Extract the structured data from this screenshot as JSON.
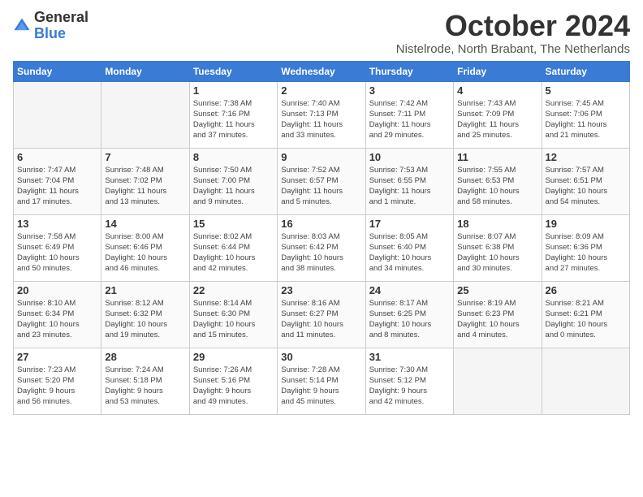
{
  "header": {
    "logo_general": "General",
    "logo_blue": "Blue",
    "month_title": "October 2024",
    "location": "Nistelrode, North Brabant, The Netherlands"
  },
  "weekdays": [
    "Sunday",
    "Monday",
    "Tuesday",
    "Wednesday",
    "Thursday",
    "Friday",
    "Saturday"
  ],
  "weeks": [
    [
      {
        "day": "",
        "detail": ""
      },
      {
        "day": "",
        "detail": ""
      },
      {
        "day": "1",
        "detail": "Sunrise: 7:38 AM\nSunset: 7:16 PM\nDaylight: 11 hours\nand 37 minutes."
      },
      {
        "day": "2",
        "detail": "Sunrise: 7:40 AM\nSunset: 7:13 PM\nDaylight: 11 hours\nand 33 minutes."
      },
      {
        "day": "3",
        "detail": "Sunrise: 7:42 AM\nSunset: 7:11 PM\nDaylight: 11 hours\nand 29 minutes."
      },
      {
        "day": "4",
        "detail": "Sunrise: 7:43 AM\nSunset: 7:09 PM\nDaylight: 11 hours\nand 25 minutes."
      },
      {
        "day": "5",
        "detail": "Sunrise: 7:45 AM\nSunset: 7:06 PM\nDaylight: 11 hours\nand 21 minutes."
      }
    ],
    [
      {
        "day": "6",
        "detail": "Sunrise: 7:47 AM\nSunset: 7:04 PM\nDaylight: 11 hours\nand 17 minutes."
      },
      {
        "day": "7",
        "detail": "Sunrise: 7:48 AM\nSunset: 7:02 PM\nDaylight: 11 hours\nand 13 minutes."
      },
      {
        "day": "8",
        "detail": "Sunrise: 7:50 AM\nSunset: 7:00 PM\nDaylight: 11 hours\nand 9 minutes."
      },
      {
        "day": "9",
        "detail": "Sunrise: 7:52 AM\nSunset: 6:57 PM\nDaylight: 11 hours\nand 5 minutes."
      },
      {
        "day": "10",
        "detail": "Sunrise: 7:53 AM\nSunset: 6:55 PM\nDaylight: 11 hours\nand 1 minute."
      },
      {
        "day": "11",
        "detail": "Sunrise: 7:55 AM\nSunset: 6:53 PM\nDaylight: 10 hours\nand 58 minutes."
      },
      {
        "day": "12",
        "detail": "Sunrise: 7:57 AM\nSunset: 6:51 PM\nDaylight: 10 hours\nand 54 minutes."
      }
    ],
    [
      {
        "day": "13",
        "detail": "Sunrise: 7:58 AM\nSunset: 6:49 PM\nDaylight: 10 hours\nand 50 minutes."
      },
      {
        "day": "14",
        "detail": "Sunrise: 8:00 AM\nSunset: 6:46 PM\nDaylight: 10 hours\nand 46 minutes."
      },
      {
        "day": "15",
        "detail": "Sunrise: 8:02 AM\nSunset: 6:44 PM\nDaylight: 10 hours\nand 42 minutes."
      },
      {
        "day": "16",
        "detail": "Sunrise: 8:03 AM\nSunset: 6:42 PM\nDaylight: 10 hours\nand 38 minutes."
      },
      {
        "day": "17",
        "detail": "Sunrise: 8:05 AM\nSunset: 6:40 PM\nDaylight: 10 hours\nand 34 minutes."
      },
      {
        "day": "18",
        "detail": "Sunrise: 8:07 AM\nSunset: 6:38 PM\nDaylight: 10 hours\nand 30 minutes."
      },
      {
        "day": "19",
        "detail": "Sunrise: 8:09 AM\nSunset: 6:36 PM\nDaylight: 10 hours\nand 27 minutes."
      }
    ],
    [
      {
        "day": "20",
        "detail": "Sunrise: 8:10 AM\nSunset: 6:34 PM\nDaylight: 10 hours\nand 23 minutes."
      },
      {
        "day": "21",
        "detail": "Sunrise: 8:12 AM\nSunset: 6:32 PM\nDaylight: 10 hours\nand 19 minutes."
      },
      {
        "day": "22",
        "detail": "Sunrise: 8:14 AM\nSunset: 6:30 PM\nDaylight: 10 hours\nand 15 minutes."
      },
      {
        "day": "23",
        "detail": "Sunrise: 8:16 AM\nSunset: 6:27 PM\nDaylight: 10 hours\nand 11 minutes."
      },
      {
        "day": "24",
        "detail": "Sunrise: 8:17 AM\nSunset: 6:25 PM\nDaylight: 10 hours\nand 8 minutes."
      },
      {
        "day": "25",
        "detail": "Sunrise: 8:19 AM\nSunset: 6:23 PM\nDaylight: 10 hours\nand 4 minutes."
      },
      {
        "day": "26",
        "detail": "Sunrise: 8:21 AM\nSunset: 6:21 PM\nDaylight: 10 hours\nand 0 minutes."
      }
    ],
    [
      {
        "day": "27",
        "detail": "Sunrise: 7:23 AM\nSunset: 5:20 PM\nDaylight: 9 hours\nand 56 minutes."
      },
      {
        "day": "28",
        "detail": "Sunrise: 7:24 AM\nSunset: 5:18 PM\nDaylight: 9 hours\nand 53 minutes."
      },
      {
        "day": "29",
        "detail": "Sunrise: 7:26 AM\nSunset: 5:16 PM\nDaylight: 9 hours\nand 49 minutes."
      },
      {
        "day": "30",
        "detail": "Sunrise: 7:28 AM\nSunset: 5:14 PM\nDaylight: 9 hours\nand 45 minutes."
      },
      {
        "day": "31",
        "detail": "Sunrise: 7:30 AM\nSunset: 5:12 PM\nDaylight: 9 hours\nand 42 minutes."
      },
      {
        "day": "",
        "detail": ""
      },
      {
        "day": "",
        "detail": ""
      }
    ]
  ]
}
